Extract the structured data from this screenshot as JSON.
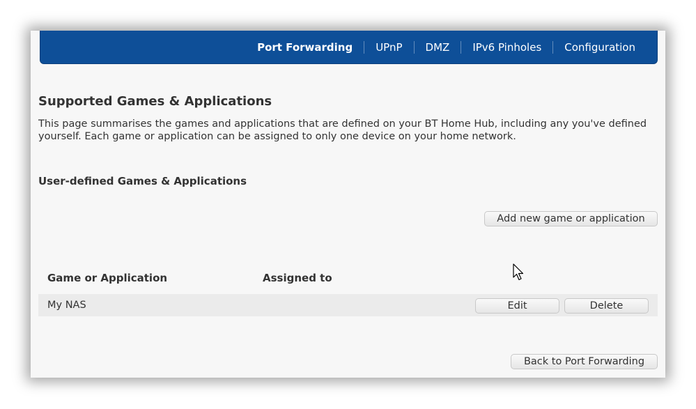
{
  "nav": {
    "items": [
      {
        "label": "Port Forwarding",
        "active": true
      },
      {
        "label": "UPnP",
        "active": false
      },
      {
        "label": "DMZ",
        "active": false
      },
      {
        "label": "IPv6 Pinholes",
        "active": false
      },
      {
        "label": "Configuration",
        "active": false
      }
    ]
  },
  "page": {
    "title": "Supported Games & Applications",
    "description": "This page summarises the games and applications that are defined on your BT Home Hub, including any you've defined yourself. Each game or application can be assigned to only one device on your home network.",
    "section_title": "User-defined Games & Applications",
    "add_button": "Add new game or application"
  },
  "table": {
    "headers": [
      "Game or Application",
      "Assigned to"
    ],
    "rows": [
      {
        "name": "My NAS",
        "assigned_to": "",
        "edit_label": "Edit",
        "delete_label": "Delete"
      }
    ]
  },
  "footer": {
    "back_button": "Back to Port Forwarding"
  },
  "colors": {
    "nav_background": "#0e4f98",
    "panel_background": "#f7f7f7",
    "row_background": "#ebebeb"
  }
}
